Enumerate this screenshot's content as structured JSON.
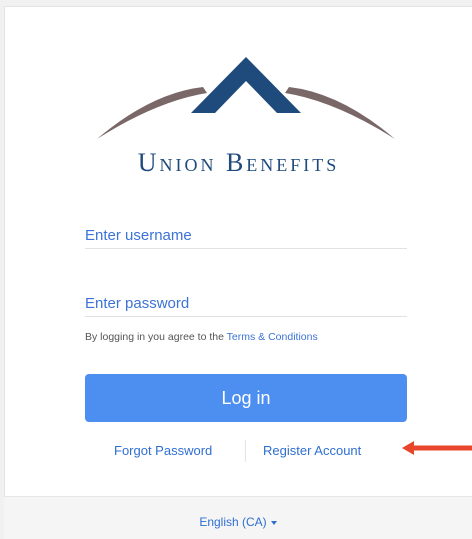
{
  "brand": {
    "name": "Union Benefits",
    "colors": {
      "navy": "#1f4a7c",
      "arc": "#7a6868",
      "accent_blue": "#4d8ff0",
      "link_blue": "#2f6fd0",
      "arrow_red": "#e8452a"
    }
  },
  "login_form": {
    "username_placeholder": "Enter username",
    "password_placeholder": "Enter password",
    "agreement_text": "By logging in you agree to the",
    "terms_link": "Terms & Conditions",
    "login_button": "Log in"
  },
  "links": {
    "forgot_password": "Forgot Password",
    "register_account": "Register Account"
  },
  "annotation": {
    "icon": "left-arrow-icon",
    "color": "#e8452a"
  },
  "footer": {
    "language": "English (CA)",
    "language_icon": "chevron-down-icon"
  }
}
